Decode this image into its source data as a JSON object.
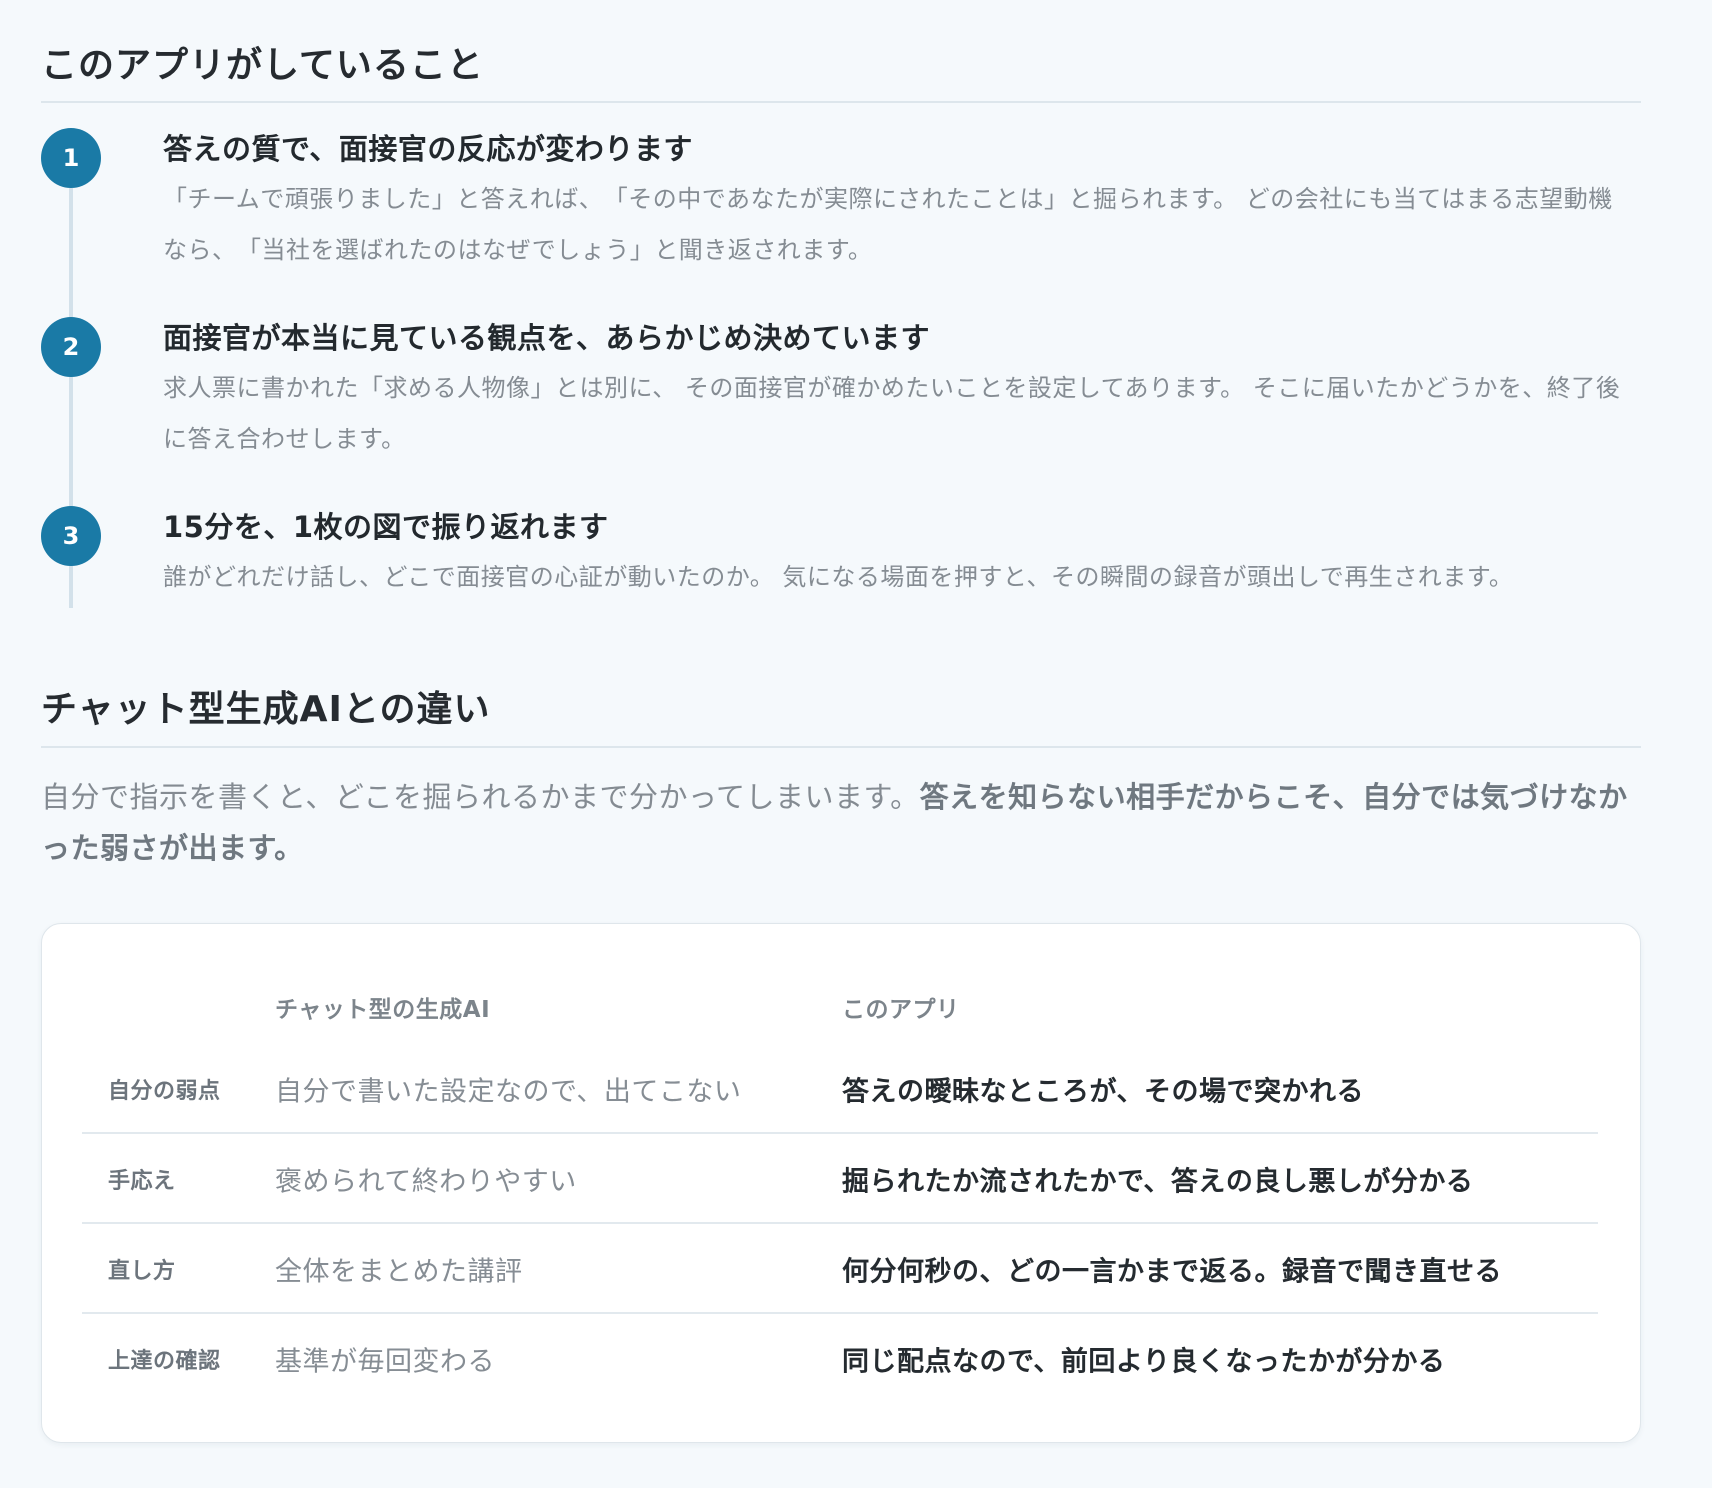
{
  "section1": {
    "title": "このアプリがしていること",
    "steps": [
      {
        "number": "1",
        "title": "答えの質で、面接官の反応が変わります",
        "body": "「チームで頑張りました」と答えれば、　「その中であなたが実際にされたことは」と掘られます。 どの会社にも当てはまる志望動機なら、　「当社を選ばれたのはなぜでしょう」と聞き返されます。"
      },
      {
        "number": "2",
        "title": "面接官が本当に見ている観点を、あらかじめ決めています",
        "body": "求人票に書かれた「求める人物像」とは別に、 その面接官が確かめたいことを設定してあります。 そこに届いたかどうかを、終了後に答え合わせします。"
      },
      {
        "number": "3",
        "title": "15分を、1枚の図で振り返れます",
        "body": "誰がどれだけ話し、どこで面接官の心証が動いたのか。 気になる場面を押すと、その瞬間の録音が頭出しで再生されます。"
      }
    ]
  },
  "section2": {
    "title": "チャット型生成AIとの違い",
    "intro_plain": "自分で指示を書くと、どこを掘られるかまで分かってしまいます。",
    "intro_strong": "答えを知らない相手だからこそ、自分では気づけなかった弱さが出ます。",
    "table": {
      "headers": {
        "label": "",
        "chat": "チャット型の生成AI",
        "app": "このアプリ"
      },
      "rows": [
        {
          "label": "自分の弱点",
          "chat": "自分で書いた設定なので、出てこない",
          "app": "答えの曖昧なところが、その場で突かれる"
        },
        {
          "label": "手応え",
          "chat": "褒められて終わりやすい",
          "app": "掘られたか流されたかで、答えの良し悪しが分かる"
        },
        {
          "label": "直し方",
          "chat": "全体をまとめた講評",
          "app": "何分何秒の、どの一言かまで返る。録音で聞き直せる"
        },
        {
          "label": "上達の確認",
          "chat": "基準が毎回変わる",
          "app": "同じ配点なので、前回より良くなったかが分かる"
        }
      ]
    }
  },
  "colors": {
    "background": "#f5f9fc",
    "accent": "#1a7aa6",
    "timeline": "#d3e1ea",
    "card": "#ffffff"
  }
}
